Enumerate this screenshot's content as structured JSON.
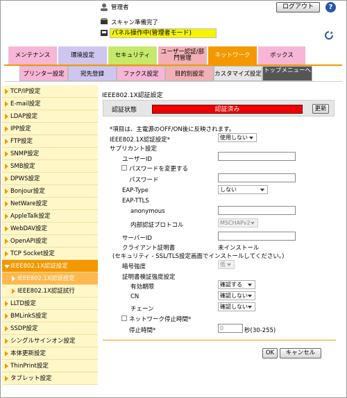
{
  "header": {
    "user": "管理者",
    "logout": "ログアウト",
    "help": "?",
    "status_scan": "スキャン準備完了",
    "status_panel": "パネル操作中(管理者モード)"
  },
  "tabs": [
    {
      "label": "メンテナンス",
      "color": "#f7b6d5"
    },
    {
      "label": "環境設定",
      "color": "#cfc6ef"
    },
    {
      "label": "セキュリティ",
      "color": "#c6e86b"
    },
    {
      "label": "ユーザー認証/部門管理",
      "color": "#f1b0b5"
    },
    {
      "label": "ネットワーク",
      "color": "#f39800"
    },
    {
      "label": "ボックス",
      "color": "#f7b6d5"
    }
  ],
  "subtabs": [
    {
      "label": "プリンター設定",
      "color": "#f7b6d5"
    },
    {
      "label": "宛先登録",
      "color": "#cfc6ef"
    },
    {
      "label": "ファクス設定",
      "color": "#f7b6d5"
    },
    {
      "label": "目的別設定",
      "color": "#f1b0b5"
    },
    {
      "label": "カスタマイズ設定",
      "color": "#e6e6e6"
    },
    {
      "label": "トップメニューへ",
      "color": "#555555"
    }
  ],
  "sidebar": [
    "TCP/IP設定",
    "E-mail設定",
    "LDAP設定",
    "IPP設定",
    "FTP設定",
    "SNMP設定",
    "SMB設定",
    "DPWS設定",
    "Bonjour設定",
    "NetWare設定",
    "AppleTalk設定",
    "WebDAV設定",
    "OpenAPI設定",
    "TCP Socket設定",
    "IEEE802.1X認証設定",
    "IEEE802.1X認証設定",
    "IEEE802.1X認証試行",
    "LLTD設定",
    "BMLinkS設定",
    "SSDP設定",
    "シングルサインオン設定",
    "本体更新設定",
    "ThinPrint設定",
    "タブレット設定"
  ],
  "main": {
    "title": "IEEE802.1X認証設定",
    "status_label": "認証状態",
    "status_value": "認証済み",
    "refresh_btn": "更新",
    "note": "*項目は、主電源のOFF/ON後に反映されます。",
    "auth_label": "IEEE802.1X認証設定*",
    "auth_value": "使用しない",
    "supplicant": "サプリカント設定",
    "user_id": "ユーザーID",
    "change_pw": "パスワードを変更する",
    "password": "パスワード",
    "eap_type": "EAP-Type",
    "eap_type_value": "しない",
    "eap_ttls": "EAP-TTLS",
    "anonymous": "anonymous",
    "inner_proto": "内部認証プロトコル",
    "inner_proto_value": "MSCHAPv2",
    "server_id": "サーバーID",
    "client_cert": "クライアント証明書",
    "client_cert_value": "未インストール",
    "cert_note": "(セキュリティ - SSL/TLS設定画面でインストールしてください。)",
    "crypto": "暗号強度",
    "crypto_value": "低",
    "cert_verify": "証明書検証強度設定",
    "validity": "有効期限",
    "validity_value": "確認する",
    "cn": "CN",
    "cn_value": "確認しない",
    "chain": "チェーン",
    "chain_value": "確認しない",
    "net_stop": "ネットワーク停止時間*",
    "stop_time": "停止時間*",
    "stop_time_value": "0",
    "stop_time_unit": "秒(30-255)",
    "ok": "OK",
    "cancel": "キャンセル"
  }
}
